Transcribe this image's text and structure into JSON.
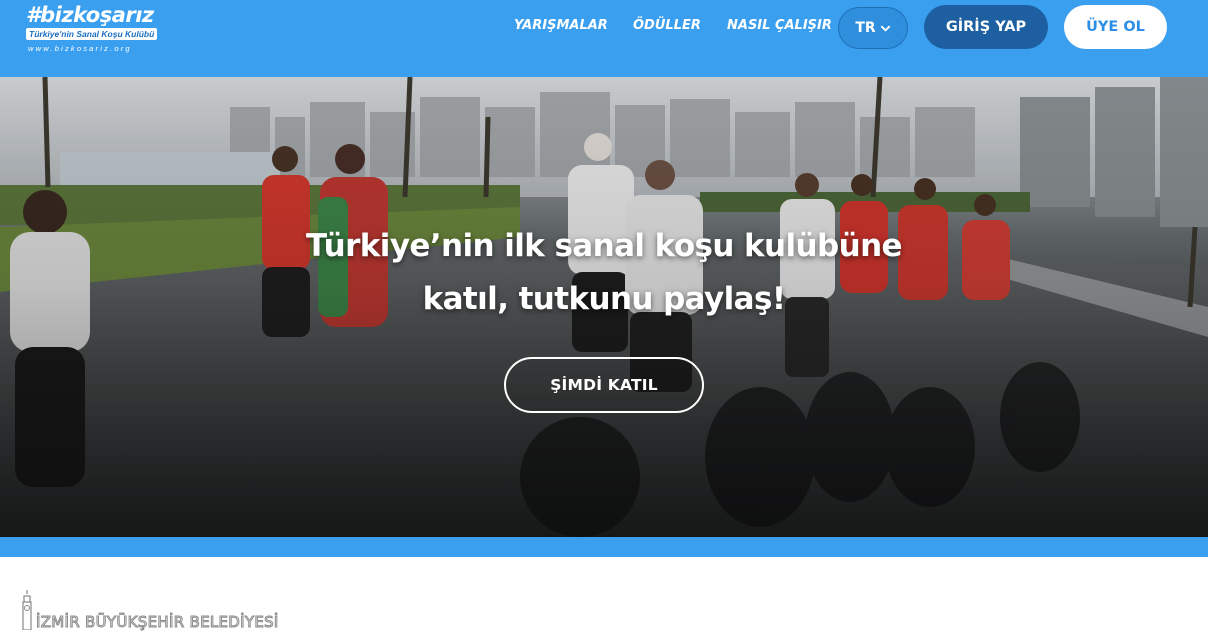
{
  "header": {
    "logo": {
      "name": "#bizkoşarız",
      "tagline": "Türkiye'nin Sanal Koşu Kulübü",
      "url": "www.bizkosariz.org"
    },
    "nav": [
      {
        "label": "YARIŞMALAR"
      },
      {
        "label": "ÖDÜLLER"
      },
      {
        "label": "NASIL ÇALIŞIR"
      }
    ],
    "language": "TR",
    "login_label": "GİRİŞ YAP",
    "signup_label": "ÜYE OL",
    "colors": {
      "bar": "#3b9ff0",
      "login_bg": "#1d5fa0",
      "signup_text": "#2c8ee6"
    }
  },
  "hero": {
    "title_line_1": "Türkiye’nin ilk sanal koşu kulübüne",
    "title_line_2": "katıl, tutkunu paylaş!",
    "cta_label": "ŞİMDİ KATIL",
    "image_subject": "group of runners on a city road"
  },
  "sponsor": {
    "name": "İZMİR BÜYÜKŞEHİR BELEDİYESİ"
  }
}
